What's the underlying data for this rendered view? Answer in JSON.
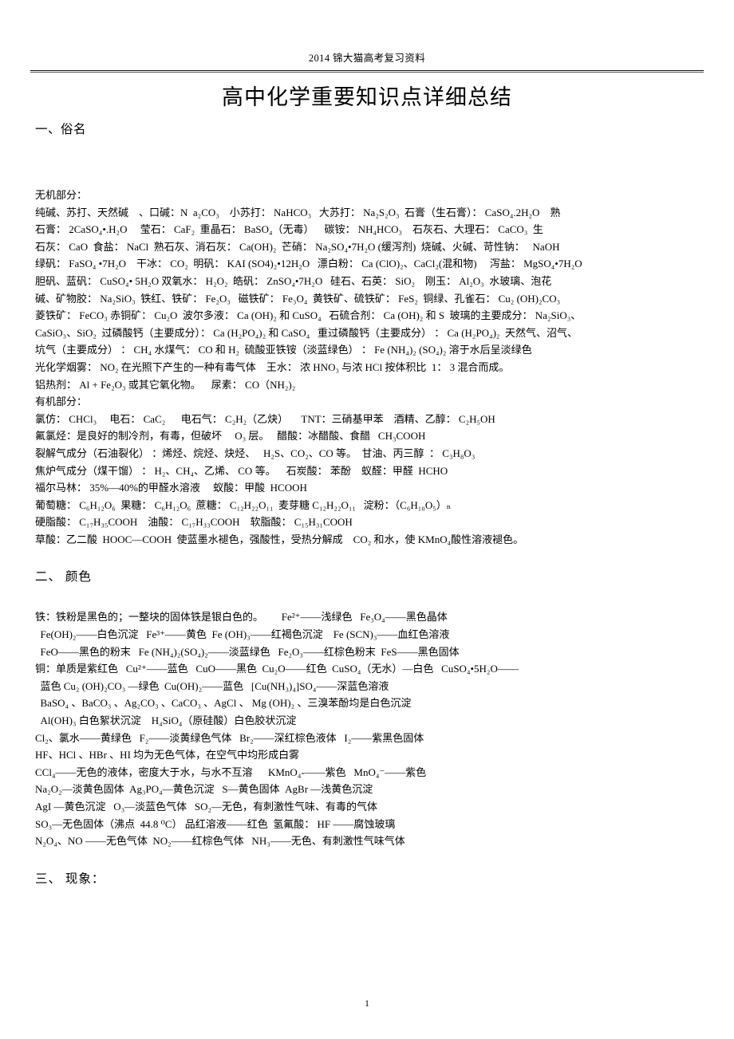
{
  "header": {
    "running_head": "2014 锦大猫高考复习资料",
    "page_number": "1"
  },
  "title": "高中化学重要知识点详细总结",
  "sections": [
    {
      "heading": "一、俗名",
      "groups": [
        {
          "label": "无机部分：",
          "lines": [
            "纯碱、苏打、天然碱    、口碱：N  a₂CO₃    小苏打： NaHCO₃   大苏打： Na₂S₂O₃  石膏（生石膏）： CaSO₄.2H₂O    熟",
            "石膏： 2CaSO₄•.H₂O     莹石： CaF₂  重晶石： BaSO₄（无毒）    碳铵： NH₄HCO₃    石灰石、大理石： CaCO₃  生",
            "石灰： CaO  食盐： NaCl  熟石灰、消石灰： Ca(OH)₂  芒硝： Na₂SO₄•7H₂O (缓泻剂)  烧碱、火碱、苛性钠：   NaOH",
            "绿矾： FaSO₄ •7H₂O    干冰： CO₂  明矾： KAI (SO4)₂•12H₂O   漂白粉： Ca (ClO)₂、CaCl₂(混和物)     泻盐： MgSO₄•7H₂O",
            "胆矾、蓝矾： CuSO₄• 5H₂O 双氧水： H₂O₂  皓矾： ZnSO₄•7H₂O   硅石、石英： SiO₂    刚玉： Al₂O₃  水玻璃、泡花",
            "碱、矿物胶： Na₂SiO₃  铁红、铁矿： Fe₂O₃   磁铁矿： Fe₃O₄  黄铁矿、硫铁矿： FeS₂  铜绿、孔雀石： Cu₂ (OH)₂CO₃",
            "菱铁矿： FeCO₃ 赤铜矿： Cu₂O  波尔多液： Ca (OH)₂ 和 CuSO₄   石硫合剂： Ca (OH)₂ 和 S  玻璃的主要成分： Na₂SiO₃、",
            "CaSiO₃、SiO₂  过磷酸钙（主要成分）： Ca (H₂PO₄)₂ 和 CaSO₄   重过磷酸钙（主要成分） ： Ca (H₂PO₄)₂  天然气、沼气、",
            "坑气（主要成分） ： CH₄ 水煤气： CO 和 H₂  硫酸亚铁铵（淡蓝绿色） ： Fe (NH₄)₂ (SO₄)₂ 溶于水后呈淡绿色",
            "光化学烟雾： NO₂ 在光照下产生的一种有毒气体    王水： 浓 HNO₃ 与浓 HCl 按体积比  1： 3 混合而成。",
            "铝热剂： Al + Fe₂O₃ 或其它氧化物。    尿素： CO（NH₂)₂"
          ]
        },
        {
          "label": "有机部分：",
          "lines": [
            "氯仿： CHCl₃     电石： CaC₂      电石气： C₂H₂（乙炔）     TNT：三硝基甲苯    酒精、乙醇： C₂H₅OH",
            "氟氯烃：是良好的制冷剂，有毒，但破坏     O₃ 层。   醋酸：冰醋酸、食醋   CH₃COOH",
            "裂解气成分（石油裂化） ：烯烃、烷烃、炔烃、   H₂S、CO₂、CO 等。  甘油、丙三醇  ： C₃H₈O₃",
            "焦炉气成分（煤干馏） ： H₂、CH₄、乙烯、 CO 等。    石炭酸： 苯酚    蚁醛：甲醛  HCHO",
            "福尔马林： 35%—40%的甲醛水溶液     蚁酸：甲酸  HCOOH",
            "葡萄糖： C₆H₁₂O₆  果糖： C₆H₁₂O₆  蔗糖： C₁₂H₂₂O₁₁  麦芽糖 C₁₂H₂₂O₁₁   淀粉：（C₆H₁₀O₅）ₙ",
            "硬脂酸： C₁₇H₃₅COOH    油酸： C₁₇H₃₃COOH    软脂酸： C₁₅H₃₁COOH",
            "草酸：乙二酸  HOOC—COOH  使蓝墨水褪色，强酸性，受热分解成    CO₂ 和水，使 KMnO₄酸性溶液褪色。"
          ]
        }
      ]
    },
    {
      "heading": "二、  颜色",
      "groups": [
        {
          "label": "",
          "lines": [
            "铁：铁粉是黑色的；一整块的固体铁是银白色的。       Fe²⁺——浅绿色   Fe₃O₄——黑色晶体",
            "  Fe(OH)₂——白色沉淀   Fe³⁺——黄色  Fe (OH)₃——红褐色沉淀    Fe (SCN)₃——血红色溶液",
            "  FeO——黑色的粉末   Fe (NH₄)₂(SO₄)₂——淡蓝绿色   Fe₂O₃——红棕色粉末  FeS——黑色固体",
            "铜：单质是紫红色   Cu²⁺——蓝色   CuO——黑色  Cu₂O——红色  CuSO₄（无水）—白色   CuSO₄•5H₂O——",
            "  蓝色 Cu₂ (OH)₂CO₃ —绿色  Cu(OH)₂——蓝色   [Cu(NH₃)₄]SO₄——深蓝色溶液",
            "  BaSO₄ 、BaCO₃ 、Ag₂CO₃ 、CaCO₃ 、AgCl 、 Mg (OH)₂ 、三溴苯酚均是白色沉淀",
            "  Al(OH)₃ 白色絮状沉淀    H₄SiO₄（原硅酸）白色胶状沉淀",
            "Cl₂、氯水——黄绿色   F₂——淡黄绿色气体   Br₂——深红棕色液体   I₂——紫黑色固体",
            "HF、HCl 、HBr 、HI 均为无色气体，在空气中均形成白雾",
            "CCl₄——无色的液体，密度大于水，与水不互溶      KMnO₄-——紫色   MnO₄⁻——紫色",
            "Na₂O₂—淡黄色固体  Ag₃PO₄—黄色沉淀   S—黄色固体  AgBr —浅黄色沉淀",
            "AgI —黄色沉淀   O₃—淡蓝色气体   SO₂—无色，有刺激性气味、有毒的气体",
            "SO₃—无色固体（沸点  44.8 ⁰C） 品红溶液——红色  氢氟酸： HF ——腐蚀玻璃",
            "N₂O₄、NO ——无色气体  NO₂——红棕色气体   NH₃——无色、有刺激性气味气体"
          ]
        }
      ]
    },
    {
      "heading": "三、  现象：",
      "groups": []
    }
  ]
}
